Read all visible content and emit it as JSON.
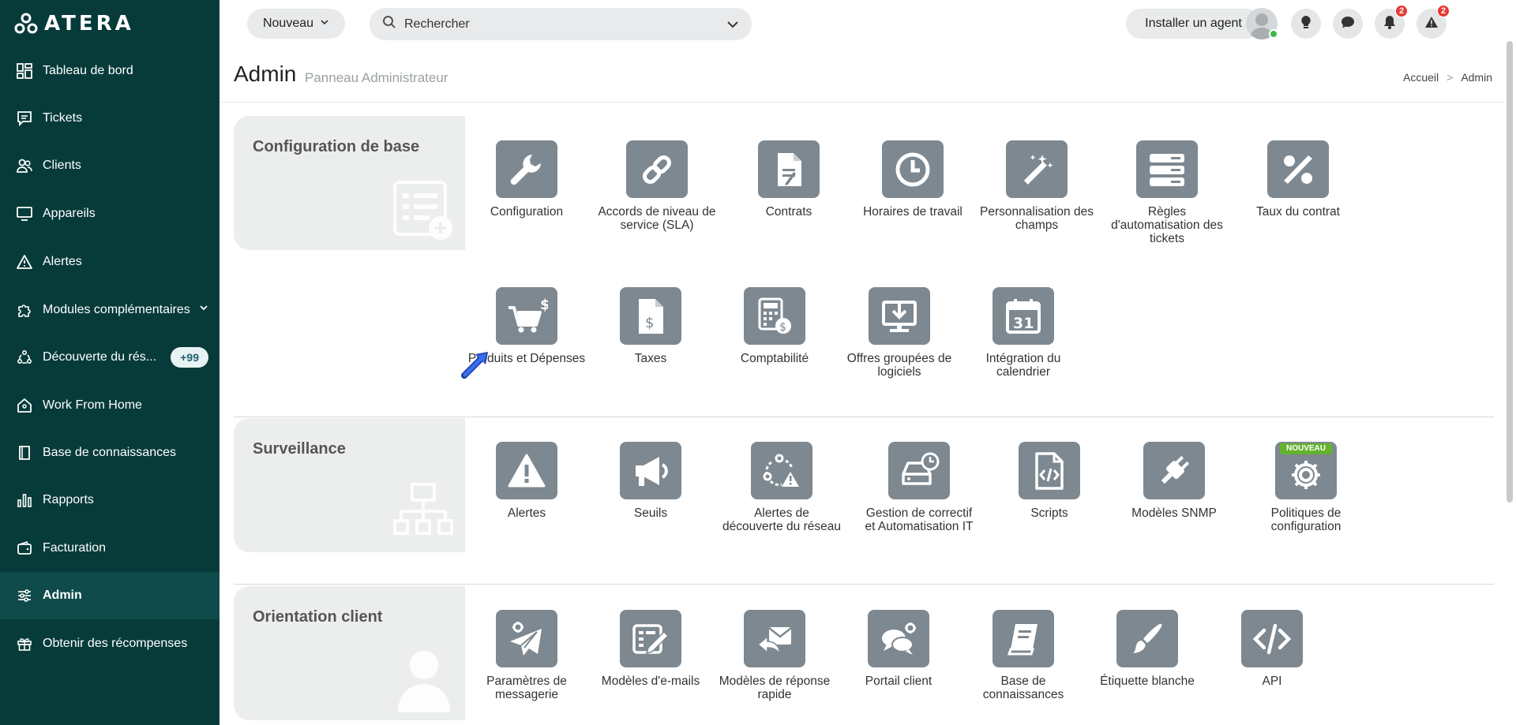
{
  "app": {
    "brand": "ATERA"
  },
  "sidebar": {
    "items": [
      {
        "label": "Tableau de bord",
        "icon": "dashboard-icon"
      },
      {
        "label": "Tickets",
        "icon": "ticket-icon"
      },
      {
        "label": "Clients",
        "icon": "users-icon"
      },
      {
        "label": "Appareils",
        "icon": "monitor-icon"
      },
      {
        "label": "Alertes",
        "icon": "alert-triangle-icon"
      },
      {
        "label": "Modules complémentaires",
        "icon": "puzzle-icon"
      },
      {
        "label": "Découverte du rés...",
        "icon": "network-discovery-icon",
        "badge": "+99"
      },
      {
        "label": "Work From Home",
        "icon": "home-icon"
      },
      {
        "label": "Base de connaissances",
        "icon": "book-icon"
      },
      {
        "label": "Rapports",
        "icon": "bar-chart-icon"
      },
      {
        "label": "Facturation",
        "icon": "wallet-icon"
      },
      {
        "label": "Admin",
        "icon": "sliders-icon",
        "active": true
      },
      {
        "label": "Obtenir des récompenses",
        "icon": "gift-icon"
      }
    ]
  },
  "topbar": {
    "new_label": "Nouveau",
    "search_placeholder": "Rechercher",
    "install_label": "Installer un agent",
    "notifications_count": "2",
    "alerts_count": "2"
  },
  "page": {
    "title": "Admin",
    "subtitle": "Panneau Administrateur",
    "breadcrumb": [
      "Accueil",
      ">",
      "Admin"
    ]
  },
  "sections": {
    "base": {
      "title": "Configuration de base",
      "tiles": [
        {
          "label": "Configuration",
          "icon": "wrench-icon"
        },
        {
          "label": "Accords de niveau de service (SLA)",
          "icon": "link-icon"
        },
        {
          "label": "Contrats",
          "icon": "contract-document-icon"
        },
        {
          "label": "Horaires de travail",
          "icon": "clock-icon"
        },
        {
          "label": "Personnalisation des champs",
          "icon": "magic-wand-icon"
        },
        {
          "label": "Règles d'automatisation des tickets",
          "icon": "server-stack-icon"
        },
        {
          "label": "Taux du contrat",
          "icon": "percent-icon"
        },
        {
          "label": "Produits et Dépenses",
          "icon": "shopping-cart-icon"
        },
        {
          "label": "Taxes",
          "icon": "tax-document-icon"
        },
        {
          "label": "Comptabilité",
          "icon": "calculator-icon"
        },
        {
          "label": "Offres groupées de logiciels",
          "icon": "download-monitor-icon"
        },
        {
          "label": "Intégration du calendrier",
          "icon": "calendar-icon",
          "day": "31"
        }
      ]
    },
    "monitoring": {
      "title": "Surveillance",
      "tiles": [
        {
          "label": "Alertes",
          "icon": "warning-icon"
        },
        {
          "label": "Seuils",
          "icon": "megaphone-icon"
        },
        {
          "label": "Alertes de découverte du réseau",
          "icon": "discovery-alert-icon"
        },
        {
          "label": "Gestion de correctif et Automatisation IT",
          "icon": "drive-clock-icon"
        },
        {
          "label": "Scripts",
          "icon": "script-icon"
        },
        {
          "label": "Modèles SNMP",
          "icon": "plug-icon"
        },
        {
          "label": "Politiques de configuration",
          "icon": "gear-icon",
          "tag": "NOUVEAU"
        }
      ]
    },
    "client": {
      "title": "Orientation client",
      "tiles": [
        {
          "label": "Paramètres de messagerie",
          "icon": "paper-plane-gear-icon"
        },
        {
          "label": "Modèles d'e-mails",
          "icon": "email-template-icon"
        },
        {
          "label": "Modèles de réponse rapide",
          "icon": "quick-reply-icon"
        },
        {
          "label": "Portail client",
          "icon": "chat-gear-icon"
        },
        {
          "label": "Base de connaissances",
          "icon": "book-icon"
        },
        {
          "label": "Étiquette blanche",
          "icon": "brush-icon"
        },
        {
          "label": "API",
          "icon": "code-icon"
        }
      ]
    }
  }
}
